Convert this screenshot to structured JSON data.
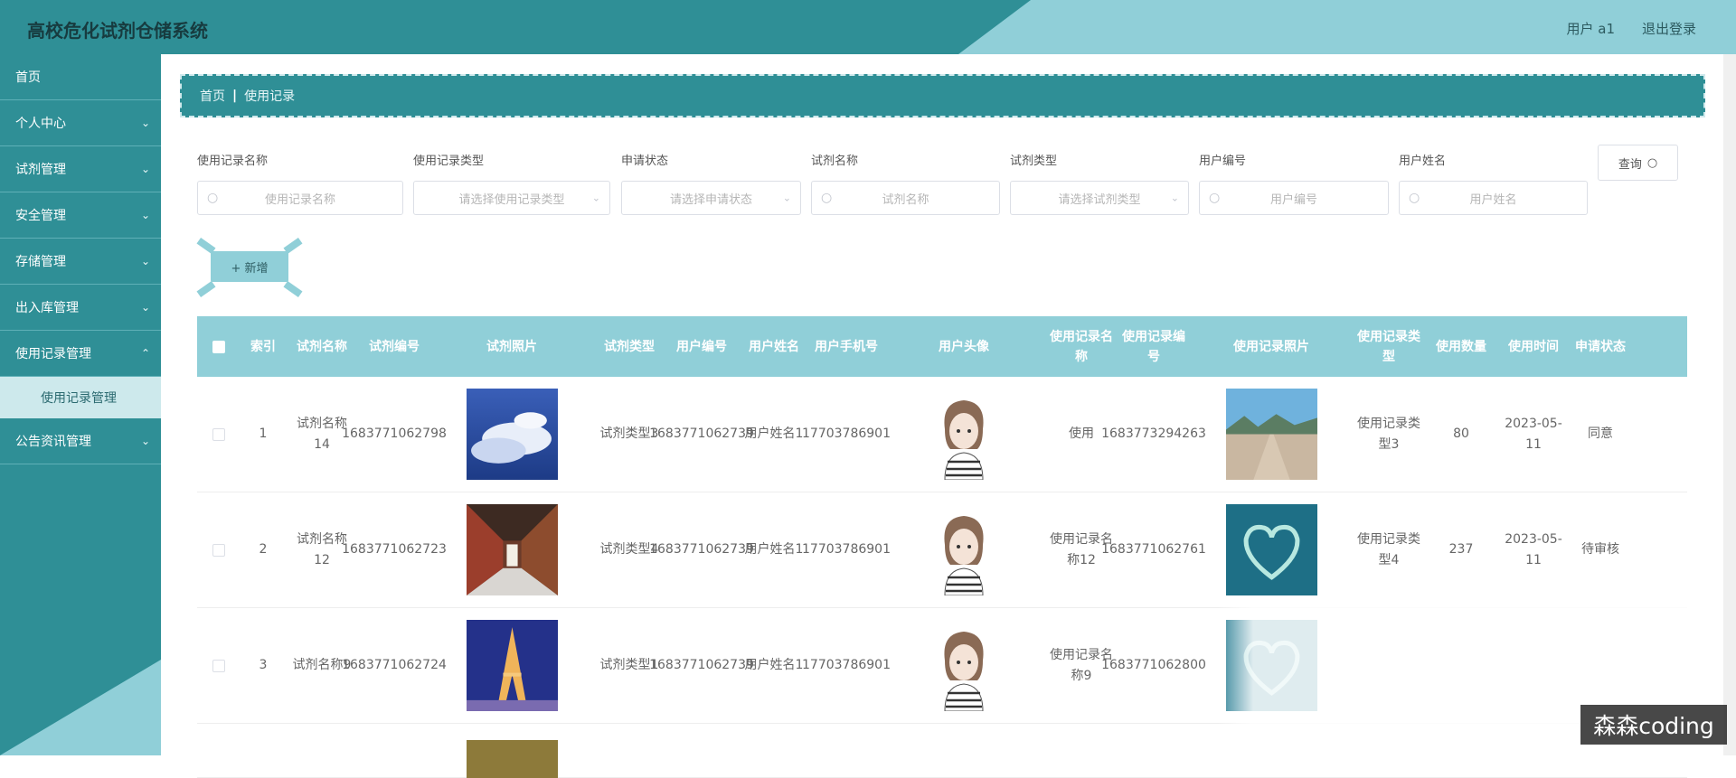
{
  "header": {
    "title": "高校危化试剂仓储系统",
    "user_label": "用户 a1",
    "logout_label": "退出登录"
  },
  "sidebar": {
    "items": [
      {
        "label": "首页",
        "has_children": false
      },
      {
        "label": "个人中心",
        "has_children": true
      },
      {
        "label": "试剂管理",
        "has_children": true
      },
      {
        "label": "安全管理",
        "has_children": true
      },
      {
        "label": "存储管理",
        "has_children": true
      },
      {
        "label": "出入库管理",
        "has_children": true
      },
      {
        "label": "使用记录管理",
        "has_children": true,
        "expanded": true
      },
      {
        "label": "公告资讯管理",
        "has_children": true
      }
    ],
    "subitem_active": "使用记录管理"
  },
  "breadcrumb": {
    "home": "首页",
    "current": "使用记录"
  },
  "filters": [
    {
      "label": "使用记录名称",
      "placeholder": "使用记录名称",
      "kind": "input"
    },
    {
      "label": "使用记录类型",
      "placeholder": "请选择使用记录类型",
      "kind": "select"
    },
    {
      "label": "申请状态",
      "placeholder": "请选择申请状态",
      "kind": "select"
    },
    {
      "label": "试剂名称",
      "placeholder": "试剂名称",
      "kind": "input"
    },
    {
      "label": "试剂类型",
      "placeholder": "请选择试剂类型",
      "kind": "select"
    },
    {
      "label": "用户编号",
      "placeholder": "用户编号",
      "kind": "input"
    },
    {
      "label": "用户姓名",
      "placeholder": "用户姓名",
      "kind": "input"
    }
  ],
  "buttons": {
    "query": "查询",
    "add": "+ 新增"
  },
  "table": {
    "headers": [
      "索引",
      "试剂名称",
      "试剂编号",
      "试剂照片",
      "试剂类型",
      "用户编号",
      "用户姓名",
      "用户手机号",
      "用户头像",
      "使用记录名称",
      "使用记录编号",
      "使用记录照片",
      "使用记录类型",
      "使用数量",
      "使用时间",
      "申请状态"
    ],
    "rows": [
      {
        "index": "1",
        "reagent_name": "试剂名称14",
        "reagent_no": "1683771062798",
        "reagent_type": "试剂类型3",
        "user_no": "1683771062739",
        "user_name": "用户姓名1",
        "phone": "17703786901",
        "record_name": "使用",
        "record_no": "1683773294263",
        "record_type": "使用记录类型3",
        "qty": "80",
        "time": "2023-05-11",
        "status": "同意"
      },
      {
        "index": "2",
        "reagent_name": "试剂名称12",
        "reagent_no": "1683771062723",
        "reagent_type": "试剂类型4",
        "user_no": "1683771062739",
        "user_name": "用户姓名1",
        "phone": "17703786901",
        "record_name": "使用记录名称12",
        "record_no": "1683771062761",
        "record_type": "使用记录类型4",
        "qty": "237",
        "time": "2023-05-11",
        "status": "待审核"
      },
      {
        "index": "3",
        "reagent_name": "试剂名称9",
        "reagent_no": "1683771062724",
        "reagent_type": "试剂类型1",
        "user_no": "1683771062739",
        "user_name": "用户姓名1",
        "phone": "17703786901",
        "record_name": "使用记录名称9",
        "record_no": "1683771062800",
        "record_type": "",
        "qty": "",
        "time": "",
        "status": ""
      }
    ]
  },
  "watermark": "森森coding",
  "colors": {
    "primary": "#2f8f96",
    "accent": "#90cfd8"
  }
}
